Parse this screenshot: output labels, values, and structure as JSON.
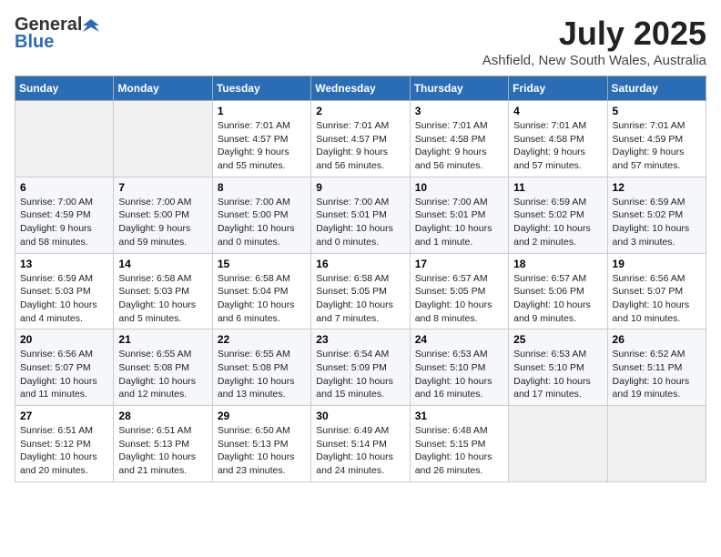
{
  "logo": {
    "general": "General",
    "blue": "Blue"
  },
  "header": {
    "month_year": "July 2025",
    "location": "Ashfield, New South Wales, Australia"
  },
  "days_of_week": [
    "Sunday",
    "Monday",
    "Tuesday",
    "Wednesday",
    "Thursday",
    "Friday",
    "Saturday"
  ],
  "weeks": [
    [
      {
        "day": "",
        "info": ""
      },
      {
        "day": "",
        "info": ""
      },
      {
        "day": "1",
        "info": "Sunrise: 7:01 AM\nSunset: 4:57 PM\nDaylight: 9 hours and 55 minutes."
      },
      {
        "day": "2",
        "info": "Sunrise: 7:01 AM\nSunset: 4:57 PM\nDaylight: 9 hours and 56 minutes."
      },
      {
        "day": "3",
        "info": "Sunrise: 7:01 AM\nSunset: 4:58 PM\nDaylight: 9 hours and 56 minutes."
      },
      {
        "day": "4",
        "info": "Sunrise: 7:01 AM\nSunset: 4:58 PM\nDaylight: 9 hours and 57 minutes."
      },
      {
        "day": "5",
        "info": "Sunrise: 7:01 AM\nSunset: 4:59 PM\nDaylight: 9 hours and 57 minutes."
      }
    ],
    [
      {
        "day": "6",
        "info": "Sunrise: 7:00 AM\nSunset: 4:59 PM\nDaylight: 9 hours and 58 minutes."
      },
      {
        "day": "7",
        "info": "Sunrise: 7:00 AM\nSunset: 5:00 PM\nDaylight: 9 hours and 59 minutes."
      },
      {
        "day": "8",
        "info": "Sunrise: 7:00 AM\nSunset: 5:00 PM\nDaylight: 10 hours and 0 minutes."
      },
      {
        "day": "9",
        "info": "Sunrise: 7:00 AM\nSunset: 5:01 PM\nDaylight: 10 hours and 0 minutes."
      },
      {
        "day": "10",
        "info": "Sunrise: 7:00 AM\nSunset: 5:01 PM\nDaylight: 10 hours and 1 minute."
      },
      {
        "day": "11",
        "info": "Sunrise: 6:59 AM\nSunset: 5:02 PM\nDaylight: 10 hours and 2 minutes."
      },
      {
        "day": "12",
        "info": "Sunrise: 6:59 AM\nSunset: 5:02 PM\nDaylight: 10 hours and 3 minutes."
      }
    ],
    [
      {
        "day": "13",
        "info": "Sunrise: 6:59 AM\nSunset: 5:03 PM\nDaylight: 10 hours and 4 minutes."
      },
      {
        "day": "14",
        "info": "Sunrise: 6:58 AM\nSunset: 5:03 PM\nDaylight: 10 hours and 5 minutes."
      },
      {
        "day": "15",
        "info": "Sunrise: 6:58 AM\nSunset: 5:04 PM\nDaylight: 10 hours and 6 minutes."
      },
      {
        "day": "16",
        "info": "Sunrise: 6:58 AM\nSunset: 5:05 PM\nDaylight: 10 hours and 7 minutes."
      },
      {
        "day": "17",
        "info": "Sunrise: 6:57 AM\nSunset: 5:05 PM\nDaylight: 10 hours and 8 minutes."
      },
      {
        "day": "18",
        "info": "Sunrise: 6:57 AM\nSunset: 5:06 PM\nDaylight: 10 hours and 9 minutes."
      },
      {
        "day": "19",
        "info": "Sunrise: 6:56 AM\nSunset: 5:07 PM\nDaylight: 10 hours and 10 minutes."
      }
    ],
    [
      {
        "day": "20",
        "info": "Sunrise: 6:56 AM\nSunset: 5:07 PM\nDaylight: 10 hours and 11 minutes."
      },
      {
        "day": "21",
        "info": "Sunrise: 6:55 AM\nSunset: 5:08 PM\nDaylight: 10 hours and 12 minutes."
      },
      {
        "day": "22",
        "info": "Sunrise: 6:55 AM\nSunset: 5:08 PM\nDaylight: 10 hours and 13 minutes."
      },
      {
        "day": "23",
        "info": "Sunrise: 6:54 AM\nSunset: 5:09 PM\nDaylight: 10 hours and 15 minutes."
      },
      {
        "day": "24",
        "info": "Sunrise: 6:53 AM\nSunset: 5:10 PM\nDaylight: 10 hours and 16 minutes."
      },
      {
        "day": "25",
        "info": "Sunrise: 6:53 AM\nSunset: 5:10 PM\nDaylight: 10 hours and 17 minutes."
      },
      {
        "day": "26",
        "info": "Sunrise: 6:52 AM\nSunset: 5:11 PM\nDaylight: 10 hours and 19 minutes."
      }
    ],
    [
      {
        "day": "27",
        "info": "Sunrise: 6:51 AM\nSunset: 5:12 PM\nDaylight: 10 hours and 20 minutes."
      },
      {
        "day": "28",
        "info": "Sunrise: 6:51 AM\nSunset: 5:13 PM\nDaylight: 10 hours and 21 minutes."
      },
      {
        "day": "29",
        "info": "Sunrise: 6:50 AM\nSunset: 5:13 PM\nDaylight: 10 hours and 23 minutes."
      },
      {
        "day": "30",
        "info": "Sunrise: 6:49 AM\nSunset: 5:14 PM\nDaylight: 10 hours and 24 minutes."
      },
      {
        "day": "31",
        "info": "Sunrise: 6:48 AM\nSunset: 5:15 PM\nDaylight: 10 hours and 26 minutes."
      },
      {
        "day": "",
        "info": ""
      },
      {
        "day": "",
        "info": ""
      }
    ]
  ]
}
